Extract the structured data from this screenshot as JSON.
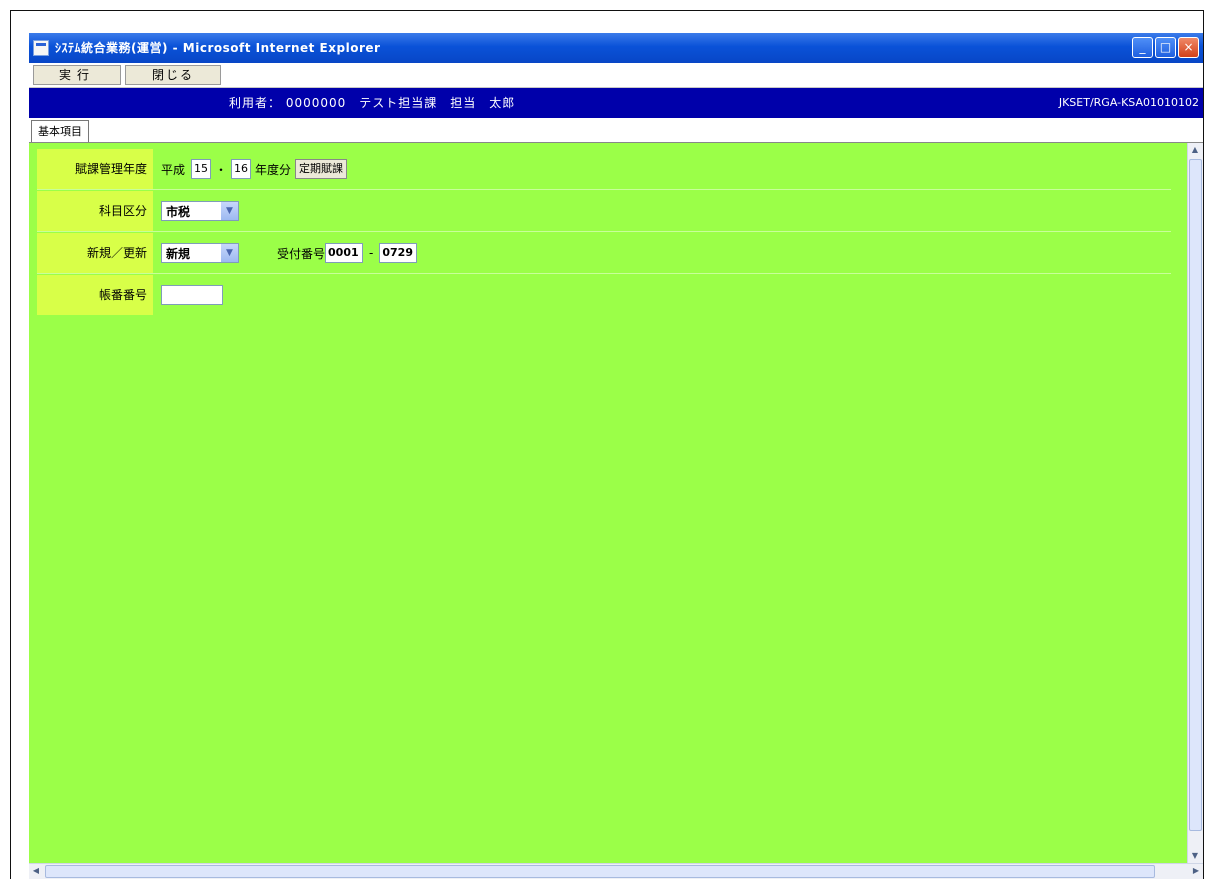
{
  "window": {
    "title": "ｼｽﾃﾑ統合業務(運営) - Microsoft Internet Explorer",
    "controls": {
      "minimize": "_",
      "maximize": "□",
      "close": "×"
    }
  },
  "toolbar": {
    "print_label": "実行",
    "close_label": "閉じる"
  },
  "userbar": {
    "user_info": "利用者： 0000000　テスト担当課　担当　太郎",
    "screen_id": "JKSET/RGA-KSA01010102"
  },
  "tabs": [
    {
      "label": "基本項目"
    }
  ],
  "form": {
    "fiscal_year": {
      "label": "賦課管理年度",
      "era": "平成",
      "year_from": "15",
      "separator": "・",
      "year_to": "16",
      "suffix": "年度分",
      "button": "定期賦課"
    },
    "category": {
      "label": "科目区分",
      "value": "市税"
    },
    "new_change": {
      "label": "新規／更新",
      "value": "新規",
      "receipt_label": "受付番号",
      "receipt_from": "0001",
      "receipt_dash": "-",
      "receipt_to": "0729"
    },
    "document_no": {
      "label": "帳番番号",
      "value": ""
    }
  }
}
